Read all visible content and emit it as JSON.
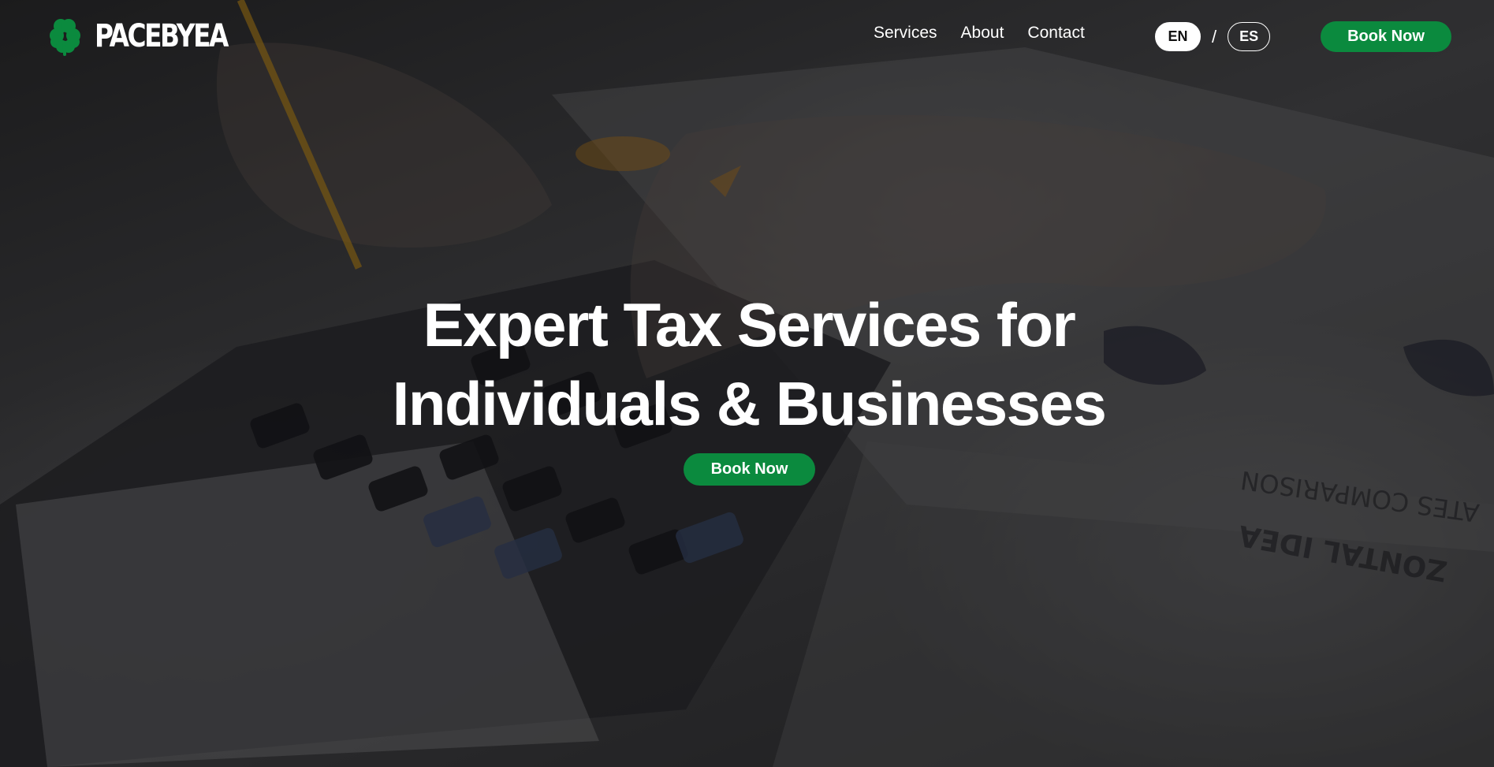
{
  "brand": {
    "name": "PACEBYEA",
    "logo_icon": "four-leaf-clover-icon",
    "accent_color": "#0b8a3e"
  },
  "nav": {
    "items": [
      {
        "label": "Services"
      },
      {
        "label": "About"
      },
      {
        "label": "Contact"
      }
    ]
  },
  "language": {
    "options": [
      "EN",
      "ES"
    ],
    "separator": "/",
    "selected": "EN"
  },
  "header": {
    "cta_label": "Book Now"
  },
  "hero": {
    "title_line1": "Expert Tax Services for",
    "title_line2": "Individuals & Businesses",
    "cta_label": "Book Now",
    "background_image": "hands-using-calculator-with-documents"
  }
}
